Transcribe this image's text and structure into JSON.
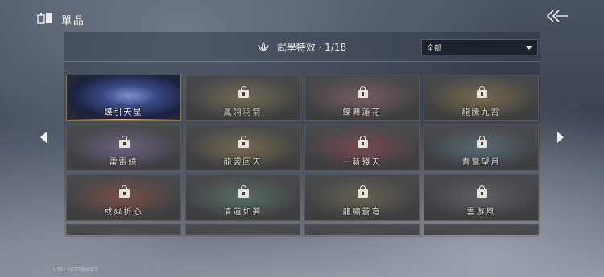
{
  "header": {
    "title": "單品",
    "title_icon": "bag-icon",
    "back_icon": "double-chevron-left-icon"
  },
  "section": {
    "title": "武學特效 · 1/18",
    "icon": "lotus-icon"
  },
  "filter": {
    "selected": "全部"
  },
  "items": [
    {
      "name": "蝶引天星",
      "state": "selected",
      "art": "#5f74c2"
    },
    {
      "name": "鳳翎羽箭",
      "state": "locked",
      "art": "#a89a62"
    },
    {
      "name": "蝶舞蓮花",
      "state": "locked",
      "art": "#b07a82"
    },
    {
      "name": "龍騰九霄",
      "state": "locked",
      "art": "#b39a55"
    },
    {
      "name": "雷電繞",
      "state": "locked",
      "art": "#9a84c4"
    },
    {
      "name": "龍裳回天",
      "state": "locked",
      "art": "#b09a5a"
    },
    {
      "name": "一斬殘天",
      "state": "locked",
      "art": "#b0505a"
    },
    {
      "name": "青鸞望月",
      "state": "locked",
      "art": "#6f9aa8"
    },
    {
      "name": "戍焱折心",
      "state": "locked",
      "art": "#b65a4a"
    },
    {
      "name": "清蓮如夢",
      "state": "locked",
      "art": "#6ea08a"
    },
    {
      "name": "龍嘯蒼穹",
      "state": "locked",
      "art": "#8a8460"
    },
    {
      "name": "雲游風",
      "state": "locked",
      "art": "#7d8088"
    },
    {
      "name": "",
      "state": "locked",
      "art": "#6a6a70"
    },
    {
      "name": "",
      "state": "locked",
      "art": "#6a6a70"
    },
    {
      "name": "",
      "state": "locked",
      "art": "#6a6a70"
    },
    {
      "name": "",
      "state": "locked",
      "art": "#6a6a70"
    }
  ],
  "uid": "UID:107780887",
  "colors": {
    "gold_accent": "#e8c373",
    "card_bg": "#444447"
  }
}
